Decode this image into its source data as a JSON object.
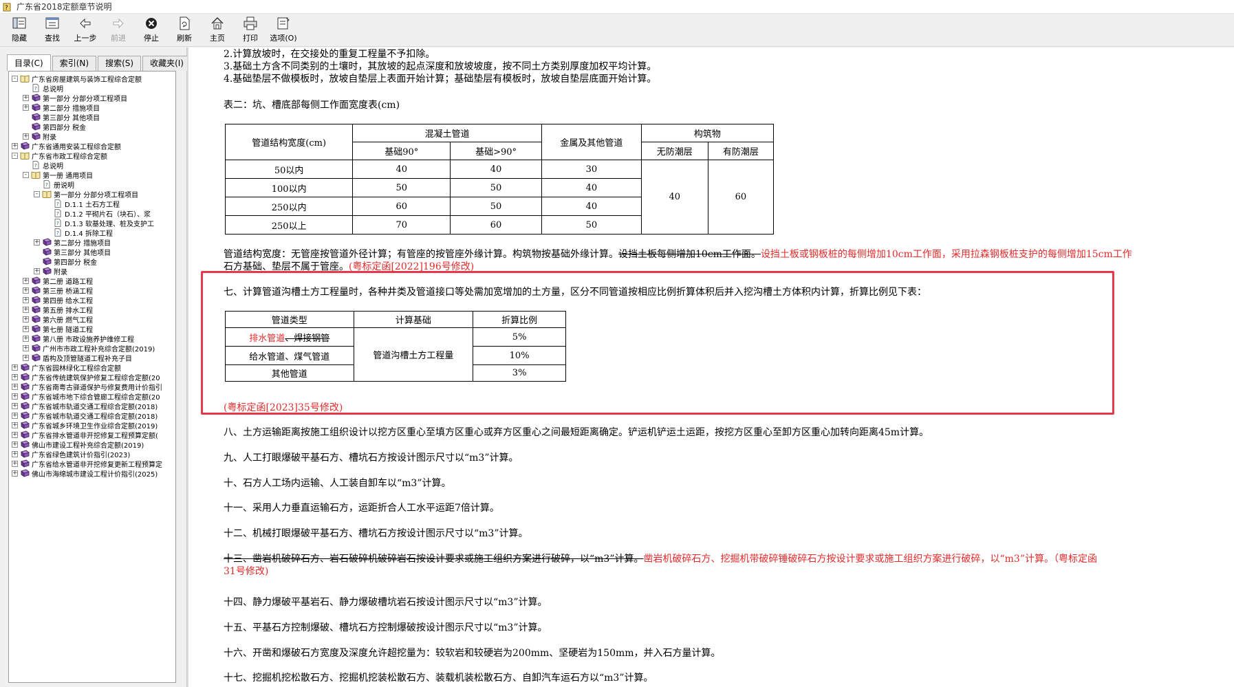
{
  "window": {
    "title": "广东省2018定额章节说明"
  },
  "toolbar": {
    "buttons": [
      {
        "label": "隐藏",
        "icon": "hide-icon"
      },
      {
        "label": "查找",
        "icon": "find-icon"
      },
      {
        "label": "上一步",
        "icon": "back-arrow-icon"
      },
      {
        "label": "前进",
        "icon": "forward-arrow-icon",
        "disabled": true
      },
      {
        "label": "停止",
        "icon": "stop-icon"
      },
      {
        "label": "刷新",
        "icon": "refresh-icon"
      },
      {
        "label": "主页",
        "icon": "home-icon"
      },
      {
        "label": "打印",
        "icon": "print-icon"
      },
      {
        "label": "选项(O)",
        "icon": "options-icon"
      }
    ]
  },
  "nav_tabs": [
    "目录(C)",
    "索引(N)",
    "搜索(S)",
    "收藏夹(I)"
  ],
  "tree": [
    {
      "label": "广东省房屋建筑与装饰工程综合定额",
      "level": 0,
      "exp": "-",
      "icon": "book-open-icon"
    },
    {
      "label": "总说明",
      "level": 1,
      "exp": "",
      "icon": "page-icon"
    },
    {
      "label": "第一部分 分部分项工程项目",
      "level": 1,
      "exp": "+",
      "icon": "book-closed-icon"
    },
    {
      "label": "第二部分 措施项目",
      "level": 1,
      "exp": "+",
      "icon": "book-closed-icon"
    },
    {
      "label": "第三部分 其他项目",
      "level": 1,
      "exp": "",
      "icon": "book-closed-icon"
    },
    {
      "label": "第四部分 税金",
      "level": 1,
      "exp": "",
      "icon": "book-closed-icon"
    },
    {
      "label": "附录",
      "level": 1,
      "exp": "+",
      "icon": "book-closed-icon"
    },
    {
      "label": "广东省通用安装工程综合定额",
      "level": 0,
      "exp": "+",
      "icon": "book-closed-icon"
    },
    {
      "label": "广东省市政工程综合定额",
      "level": 0,
      "exp": "-",
      "icon": "book-open-icon"
    },
    {
      "label": "总说明",
      "level": 1,
      "exp": "",
      "icon": "page-icon"
    },
    {
      "label": "第一册 通用项目",
      "level": 1,
      "exp": "-",
      "icon": "book-open-icon"
    },
    {
      "label": "册说明",
      "level": 2,
      "exp": "",
      "icon": "page-icon"
    },
    {
      "label": "第一部分 分部分项工程项目",
      "level": 2,
      "exp": "-",
      "icon": "book-open-icon"
    },
    {
      "label": "D.1.1 土石方工程",
      "level": 3,
      "exp": "",
      "icon": "page-icon"
    },
    {
      "label": "D.1.2 平砌片石（块石）、浆",
      "level": 3,
      "exp": "",
      "icon": "page-icon"
    },
    {
      "label": "D.1.3 软基处理、桩及支护工",
      "level": 3,
      "exp": "",
      "icon": "page-icon"
    },
    {
      "label": "D.1.4 拆除工程",
      "level": 3,
      "exp": "",
      "icon": "page-icon"
    },
    {
      "label": "第二部分 措施项目",
      "level": 2,
      "exp": "+",
      "icon": "book-closed-icon"
    },
    {
      "label": "第三部分 其他项目",
      "level": 2,
      "exp": "",
      "icon": "book-closed-icon"
    },
    {
      "label": "第四部分 税金",
      "level": 2,
      "exp": "",
      "icon": "book-closed-icon"
    },
    {
      "label": "附录",
      "level": 2,
      "exp": "+",
      "icon": "book-closed-icon"
    },
    {
      "label": "第二册 道路工程",
      "level": 1,
      "exp": "+",
      "icon": "book-closed-icon"
    },
    {
      "label": "第三册 桥涵工程",
      "level": 1,
      "exp": "+",
      "icon": "book-closed-icon"
    },
    {
      "label": "第四册 给水工程",
      "level": 1,
      "exp": "+",
      "icon": "book-closed-icon"
    },
    {
      "label": "第五册 排水工程",
      "level": 1,
      "exp": "+",
      "icon": "book-closed-icon"
    },
    {
      "label": "第六册 燃气工程",
      "level": 1,
      "exp": "+",
      "icon": "book-closed-icon"
    },
    {
      "label": "第七册 隧道工程",
      "level": 1,
      "exp": "+",
      "icon": "book-closed-icon"
    },
    {
      "label": "第八册 市政设施养护维修工程",
      "level": 1,
      "exp": "+",
      "icon": "book-closed-icon"
    },
    {
      "label": "广州市市政工程补充综合定额(2019)",
      "level": 1,
      "exp": "+",
      "icon": "book-closed-icon"
    },
    {
      "label": "盾构及顶管隧道工程补充子目",
      "level": 1,
      "exp": "+",
      "icon": "book-closed-icon"
    },
    {
      "label": "广东省园林绿化工程综合定额",
      "level": 0,
      "exp": "+",
      "icon": "book-closed-icon"
    },
    {
      "label": "广东省传统建筑保护修复工程综合定额(20",
      "level": 0,
      "exp": "+",
      "icon": "book-closed-icon"
    },
    {
      "label": "广东省南粤古驿道保护与修复费用计价指引",
      "level": 0,
      "exp": "+",
      "icon": "book-closed-icon"
    },
    {
      "label": "广东省城市地下综合管廊工程综合定额(20",
      "level": 0,
      "exp": "+",
      "icon": "book-closed-icon"
    },
    {
      "label": "广东省城市轨道交通工程综合定额(2018)",
      "level": 0,
      "exp": "+",
      "icon": "book-closed-icon"
    },
    {
      "label": "广东省城市轨道交通工程综合定额(2018)",
      "level": 0,
      "exp": "+",
      "icon": "book-closed-icon"
    },
    {
      "label": "广东省城乡环境卫生作业综合定额(2019)",
      "level": 0,
      "exp": "+",
      "icon": "book-closed-icon"
    },
    {
      "label": "广东省排水管道非开挖修复工程预算定额(",
      "level": 0,
      "exp": "+",
      "icon": "book-closed-icon"
    },
    {
      "label": "佛山市建设工程补充综合定额(2019)",
      "level": 0,
      "exp": "+",
      "icon": "book-closed-icon"
    },
    {
      "label": "广东省绿色建筑计价指引(2023)",
      "level": 0,
      "exp": "+",
      "icon": "book-closed-icon"
    },
    {
      "label": "广东省给水管道非开挖修复更新工程预算定",
      "level": 0,
      "exp": "+",
      "icon": "book-closed-icon"
    },
    {
      "label": "佛山市海绵城市建设工程计价指引(2025)",
      "level": 0,
      "exp": "+",
      "icon": "book-closed-icon"
    }
  ],
  "doc": {
    "l1": "2.计算放坡时，在交接处的重复工程量不予扣除。",
    "l2": "3.基础土方含不同类别的土壤时，其放坡的起点深度和放坡坡度，按不同土方类别厚度加权平均计算。",
    "l3": "4.基础垫层不做模板时，放坡自垫层上表面开始计算；基础垫层有模板时，放坡自垫层底面开始计算。",
    "table2_caption": "表二：坑、槽底部每侧工作面宽度表(cm)",
    "table2": {
      "h_pipe_width": "管道结构宽度(cm)",
      "h_concrete": "混凝土管道",
      "h_base90": "基础90°",
      "h_base_gt90": "基础>90°",
      "h_metal": "金属及其他管道",
      "h_structure": "构筑物",
      "h_no_moisture": "无防潮层",
      "h_moisture": "有防潮层",
      "rows": [
        {
          "w": "50以内",
          "a": "40",
          "b": "40",
          "c": "30"
        },
        {
          "w": "100以内",
          "a": "50",
          "b": "50",
          "c": "40"
        },
        {
          "w": "250以内",
          "a": "60",
          "b": "50",
          "c": "40"
        },
        {
          "w": "250以上",
          "a": "70",
          "b": "60",
          "c": "50"
        }
      ],
      "struct_no": "40",
      "struct_yes": "60"
    },
    "p_width_a": "管道结构宽度：无管座按管道外径计算；有管座的按管座外缘计算。构筑物按基础外缘计算。",
    "p_width_strike": "设挡土板每侧增加10cm工作面。",
    "p_width_red": "设挡土板或钢板桩的每侧增加10cm工作面，采用拉森钢板桩支护的每侧增加15cm工作",
    "p_width2_a": "石方基础、垫层不属于管座。",
    "p_width2_red": "(粤标定函[2022]196号修改)",
    "p7": "七、计算管道沟槽土方工程量时，各种井类及管道接口等处需加宽增加的土方量，区分不同管道按相应比例折算体积后并入挖沟槽土方体积内计算，折算比例见下表：",
    "table3": {
      "h_type": "管道类型",
      "h_basis": "计算基础",
      "h_ratio": "折算比例",
      "r1_red": "排水管道",
      "r1_strike": "、焊接钢管",
      "r1_ratio": "5%",
      "r2": "给水管道、煤气管道",
      "r2_ratio": "10%",
      "r3": "其他管道",
      "r3_ratio": "3%",
      "basis": "管道沟槽土方工程量"
    },
    "p7_note": "(粤标定函[2023]35号修改)",
    "p8": "八、土方运输距离按施工组织设计以挖方区重心至填方区重心或弃方区重心之间最短距离确定。铲运机铲运土运距，按挖方区重心至卸方区重心加转向距离45m计算。",
    "p9": "九、人工打眼爆破平基石方、槽坑石方按设计图示尺寸以“m3”计算。",
    "p10": "十、石方人工场内运输、人工装自卸车以“m3”计算。",
    "p11": "十一、采用人力垂直运输石方，运距折合人工水平运距7倍计算。",
    "p12": "十二、机械打眼爆破平基石方、槽坑石方按设计图示尺寸以“m3”计算。",
    "p13_strike": "十三、凿岩机破碎石方、岩石破碎机破碎岩石按设计要求或施工组织方案进行破碎，以“m3”计算。",
    "p13_red": "凿岩机破碎石方、挖掘机带破碎锤破碎石方按设计要求或施工组织方案进行破碎，以“m3”计算。（粤标定函",
    "p13_red2": "31号修改)",
    "p14": "十四、静力爆破平基岩石、静力爆破槽坑岩石按设计图示尺寸以“m3”计算。",
    "p15": "十五、平基石方控制爆破、槽坑石方控制爆破按设计图示尺寸以“m3”计算。",
    "p16": "十六、开凿和爆破石方宽度及深度允许超挖量为：较软岩和较硬岩为200mm、坚硬岩为150mm，并入石方量计算。",
    "p17": "十七、挖掘机挖松散石方、挖掘机挖装松散石方、装载机装松散石方、自卸汽车运石方以“m3”计算。"
  }
}
